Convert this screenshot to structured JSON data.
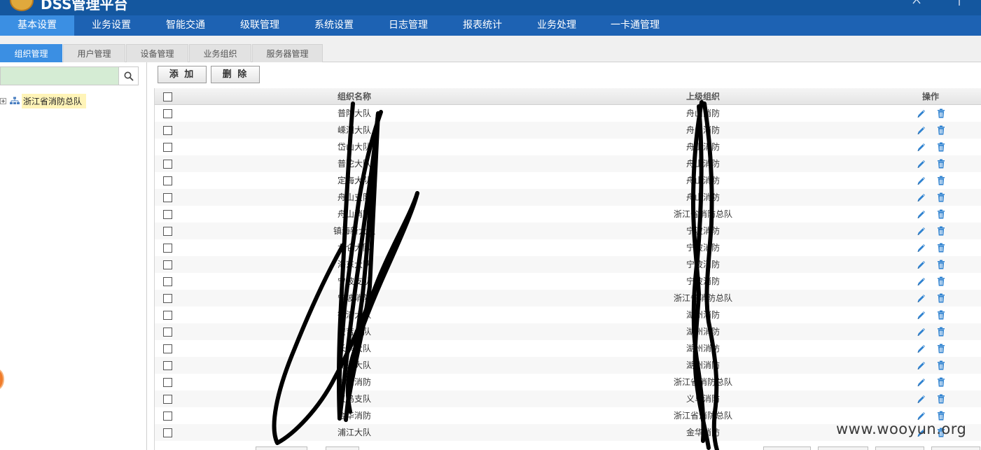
{
  "header": {
    "app_title": "DSS管理平台",
    "logo_icon": "badge-logo-icon",
    "brand_color": "#14579f"
  },
  "main_nav": {
    "items": [
      {
        "label": "基本设置",
        "active": true
      },
      {
        "label": "业务设置",
        "active": false
      },
      {
        "label": "智能交通",
        "active": false
      },
      {
        "label": "级联管理",
        "active": false
      },
      {
        "label": "系统设置",
        "active": false
      },
      {
        "label": "日志管理",
        "active": false
      },
      {
        "label": "报表统计",
        "active": false
      },
      {
        "label": "业务处理",
        "active": false
      },
      {
        "label": "一卡通管理",
        "active": false
      }
    ],
    "active_color": "#3b8fe3"
  },
  "subtabs": {
    "items": [
      {
        "label": "组织管理",
        "active": true
      },
      {
        "label": "用户管理",
        "active": false
      },
      {
        "label": "设备管理",
        "active": false
      },
      {
        "label": "业务组织",
        "active": false
      },
      {
        "label": "服务器管理",
        "active": false
      }
    ]
  },
  "left_panel": {
    "search": {
      "value": "",
      "placeholder": "",
      "icon": "search-icon"
    },
    "tree": {
      "root_label": "浙江省消防总队",
      "root_icon": "org-tree-icon",
      "expander_icon": "plus-expander-icon"
    }
  },
  "toolbar": {
    "add_label": "添 加",
    "delete_label": "删 除"
  },
  "grid": {
    "columns": {
      "name": "组织名称",
      "parent": "上级组织",
      "actions": "操作"
    },
    "action_icons": {
      "edit": "pencil-edit-icon",
      "delete": "trash-icon"
    },
    "rows": [
      {
        "name": "普陀大队",
        "parent": "舟山消防"
      },
      {
        "name": "嵊泗大队",
        "parent": "舟山消防"
      },
      {
        "name": "岱山大队",
        "parent": "舟山消防"
      },
      {
        "name": "普陀大队",
        "parent": "舟山消防"
      },
      {
        "name": "定海大队",
        "parent": "舟山消防"
      },
      {
        "name": "舟山支队",
        "parent": "舟山消防"
      },
      {
        "name": "舟山消防",
        "parent": "浙江省消防总队"
      },
      {
        "name": "镇海新大队",
        "parent": "宁波消防"
      },
      {
        "name": "北仑大队",
        "parent": "宁波消防"
      },
      {
        "name": "海东大队",
        "parent": "宁波消防"
      },
      {
        "name": "宁波支队",
        "parent": "宁波消防"
      },
      {
        "name": "宁波消防",
        "parent": "浙江省消防总队"
      },
      {
        "name": "德清大队",
        "parent": "湖州消防"
      },
      {
        "name": "安吉大队",
        "parent": "湖州消防"
      },
      {
        "name": "长兴大队",
        "parent": "湖州消防"
      },
      {
        "name": "吴兴大队",
        "parent": "湖州消防"
      },
      {
        "name": "湖州消防",
        "parent": "浙江省消防总队"
      },
      {
        "name": "义乌支队",
        "parent": "义乌消防"
      },
      {
        "name": "金华消防",
        "parent": "浙江省消防总队"
      },
      {
        "name": "浦江大队",
        "parent": "金华消防"
      }
    ]
  },
  "watermark": "www.wooyun.org"
}
